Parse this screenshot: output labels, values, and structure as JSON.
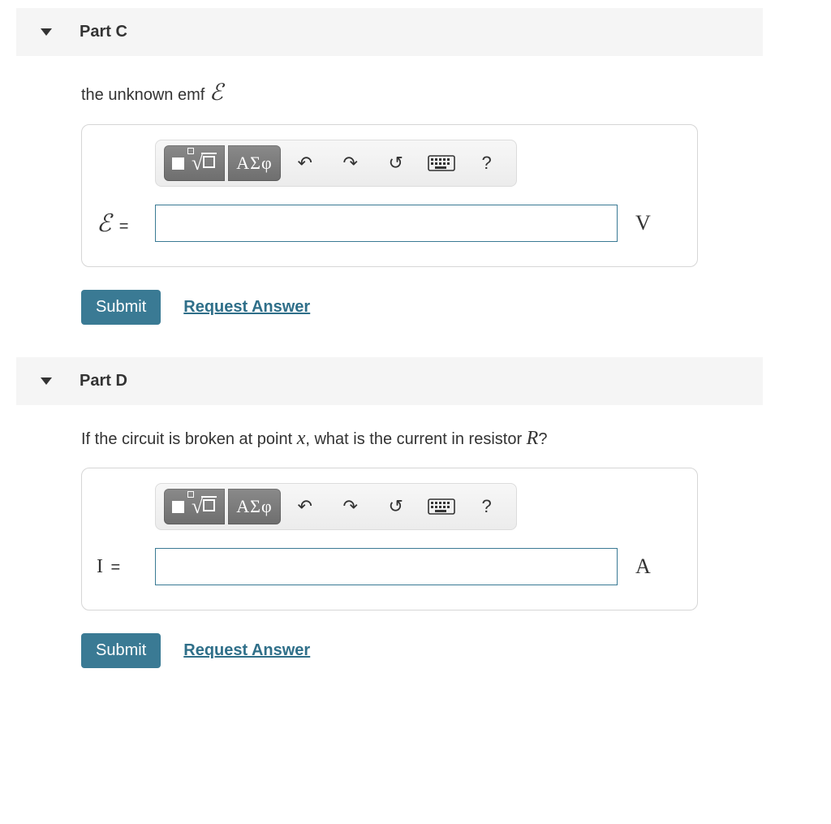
{
  "parts": [
    {
      "id": "c",
      "title": "Part C",
      "prompt_plain": "the unknown emf ",
      "prompt_symbol": "ℰ",
      "lhs_symbol": "ℰ",
      "lhs_eq": " =",
      "unit": "V"
    },
    {
      "id": "d",
      "title": "Part D",
      "prompt_pre": "If the circuit is broken at point ",
      "prompt_var": "x",
      "prompt_post": ", what is the current in resistor ",
      "prompt_var2": "R",
      "prompt_tail": "?",
      "lhs_symbol": "I",
      "lhs_eq": " =",
      "unit": "A"
    }
  ],
  "toolbar": {
    "greek_label": "ΑΣφ",
    "undo_glyph": "↶",
    "redo_glyph": "↷",
    "reset_glyph": "↺",
    "help_glyph": "?"
  },
  "actions": {
    "submit": "Submit",
    "request": "Request Answer"
  }
}
